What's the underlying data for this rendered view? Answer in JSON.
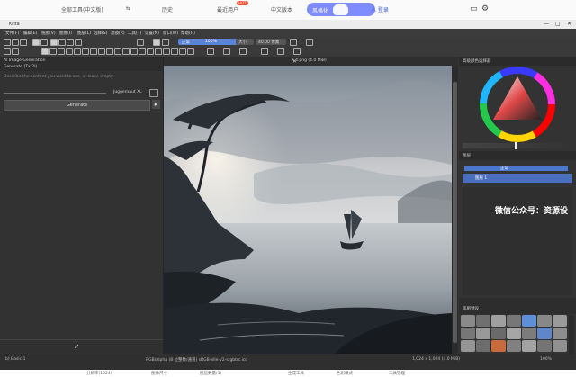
{
  "topbar": {
    "nav": [
      "全部工具(中文版)",
      "⇆",
      "历史",
      "最近用户",
      "中文版本",
      "风格化"
    ],
    "hot_badge": "HOT",
    "user": "人 登录",
    "icons": [
      "folder-icon",
      "gear-icon"
    ]
  },
  "window": {
    "title": "Krita",
    "controls": [
      "—",
      "□",
      "✕"
    ]
  },
  "menu": [
    "文件(F)",
    "编辑(E)",
    "视图(V)",
    "图像(I)",
    "图层(L)",
    "选择(S)",
    "滤镜(R)",
    "工具(T)",
    "设置(N)",
    "窗口(W)",
    "帮助(H)"
  ],
  "toolbar": {
    "blend_mode": "正常",
    "opacity": "100%",
    "size_field": "大小",
    "size_value": "40.00 像素"
  },
  "left_panel": {
    "tab1": "AI Image Generation",
    "tab2": "Generate (Txt2I)",
    "hint": "Describe the content you want to see, or leave empty.",
    "model": "Juggernaut XL",
    "generate_label": "Generate"
  },
  "canvas": {
    "doc_title": "C4.png (4.0 MiB)"
  },
  "right_panel": {
    "color_header": "高级颜色选择器",
    "layers_header": "图层",
    "layers_blend": "正常",
    "layer_name": "图层 1",
    "brush_header": "笔刷预设",
    "watermark": "微信公众号：资源设"
  },
  "status": {
    "left": "b) Basic-1",
    "center": "RGB/Alpha (8 位整数/通道) sRGB-elle-V2-srgbtrc.icc",
    "right": "1,024 x 1,024 (4.0 MiB)",
    "zoom": "100%"
  },
  "below": {
    "items": [
      "分辨率(1024)",
      "图像尺寸",
      "图层数量(1)",
      "生成工具",
      "色彩模式",
      "工具管理"
    ]
  },
  "colors": {
    "accent": "#7f8cff",
    "app_bg": "#353535",
    "selection": "#4a6fbf"
  }
}
